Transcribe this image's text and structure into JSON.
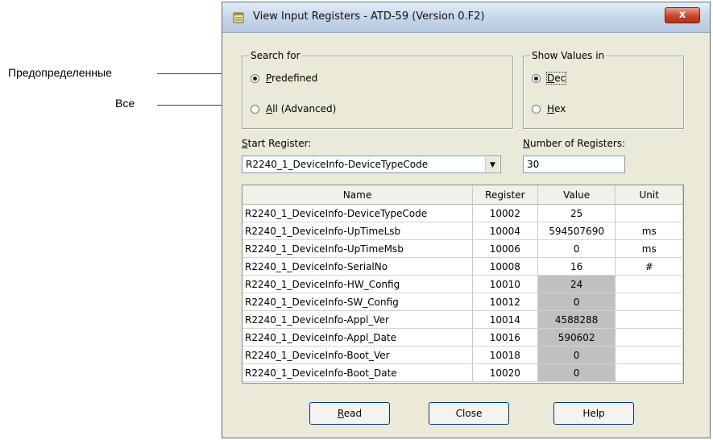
{
  "annotations": {
    "predefined_ru": "Предопределенные",
    "all_ru": "Все"
  },
  "window": {
    "title": "View Input Registers - ATD-59 (Version 0.F2)",
    "close_glyph": "x"
  },
  "search_for": {
    "title": "Search for",
    "predefined_label": "Predefined",
    "predefined_hotkey": "P",
    "predefined_rest": "redefined",
    "all_hotkey": "A",
    "all_rest": "ll (Advanced)",
    "selected": "Predefined"
  },
  "show_values_in": {
    "title": "Show Values in",
    "dec_hotkey": "D",
    "dec_rest": "ec",
    "hex_hotkey": "H",
    "hex_rest": "ex",
    "selected": "Dec"
  },
  "start_register": {
    "label_hotkey": "S",
    "label_rest": "tart Register:",
    "value": "R2240_1_DeviceInfo-DeviceTypeCode"
  },
  "number_of_registers": {
    "label_hotkey": "N",
    "label_rest": "umber of Registers:",
    "value": "30"
  },
  "table": {
    "columns": [
      "Name",
      "Register",
      "Value",
      "Unit"
    ],
    "rows": [
      {
        "name": "R2240_1_DeviceInfo-DeviceTypeCode",
        "register": "10002",
        "value": "25",
        "unit": "",
        "readonly": false
      },
      {
        "name": "R2240_1_DeviceInfo-UpTimeLsb",
        "register": "10004",
        "value": "594507690",
        "unit": "ms",
        "readonly": false
      },
      {
        "name": "R2240_1_DeviceInfo-UpTimeMsb",
        "register": "10006",
        "value": "0",
        "unit": "ms",
        "readonly": false
      },
      {
        "name": "R2240_1_DeviceInfo-SerialNo",
        "register": "10008",
        "value": "16",
        "unit": "#",
        "readonly": false
      },
      {
        "name": "R2240_1_DeviceInfo-HW_Config",
        "register": "10010",
        "value": "24",
        "unit": "",
        "readonly": true
      },
      {
        "name": "R2240_1_DeviceInfo-SW_Config",
        "register": "10012",
        "value": "0",
        "unit": "",
        "readonly": true
      },
      {
        "name": "R2240_1_DeviceInfo-Appl_Ver",
        "register": "10014",
        "value": "4588288",
        "unit": "",
        "readonly": true
      },
      {
        "name": "R2240_1_DeviceInfo-Appl_Date",
        "register": "10016",
        "value": "590602",
        "unit": "",
        "readonly": true
      },
      {
        "name": "R2240_1_DeviceInfo-Boot_Ver",
        "register": "10018",
        "value": "0",
        "unit": "",
        "readonly": true
      },
      {
        "name": "R2240_1_DeviceInfo-Boot_Date",
        "register": "10020",
        "value": "0",
        "unit": "",
        "readonly": true
      }
    ]
  },
  "buttons": {
    "read_hotkey": "R",
    "read_rest": "ead",
    "close": "Close",
    "help": "Help"
  },
  "colors": {
    "readonly_cell": "#c0c0c0",
    "dialog_bg": "#ebe9d8"
  }
}
